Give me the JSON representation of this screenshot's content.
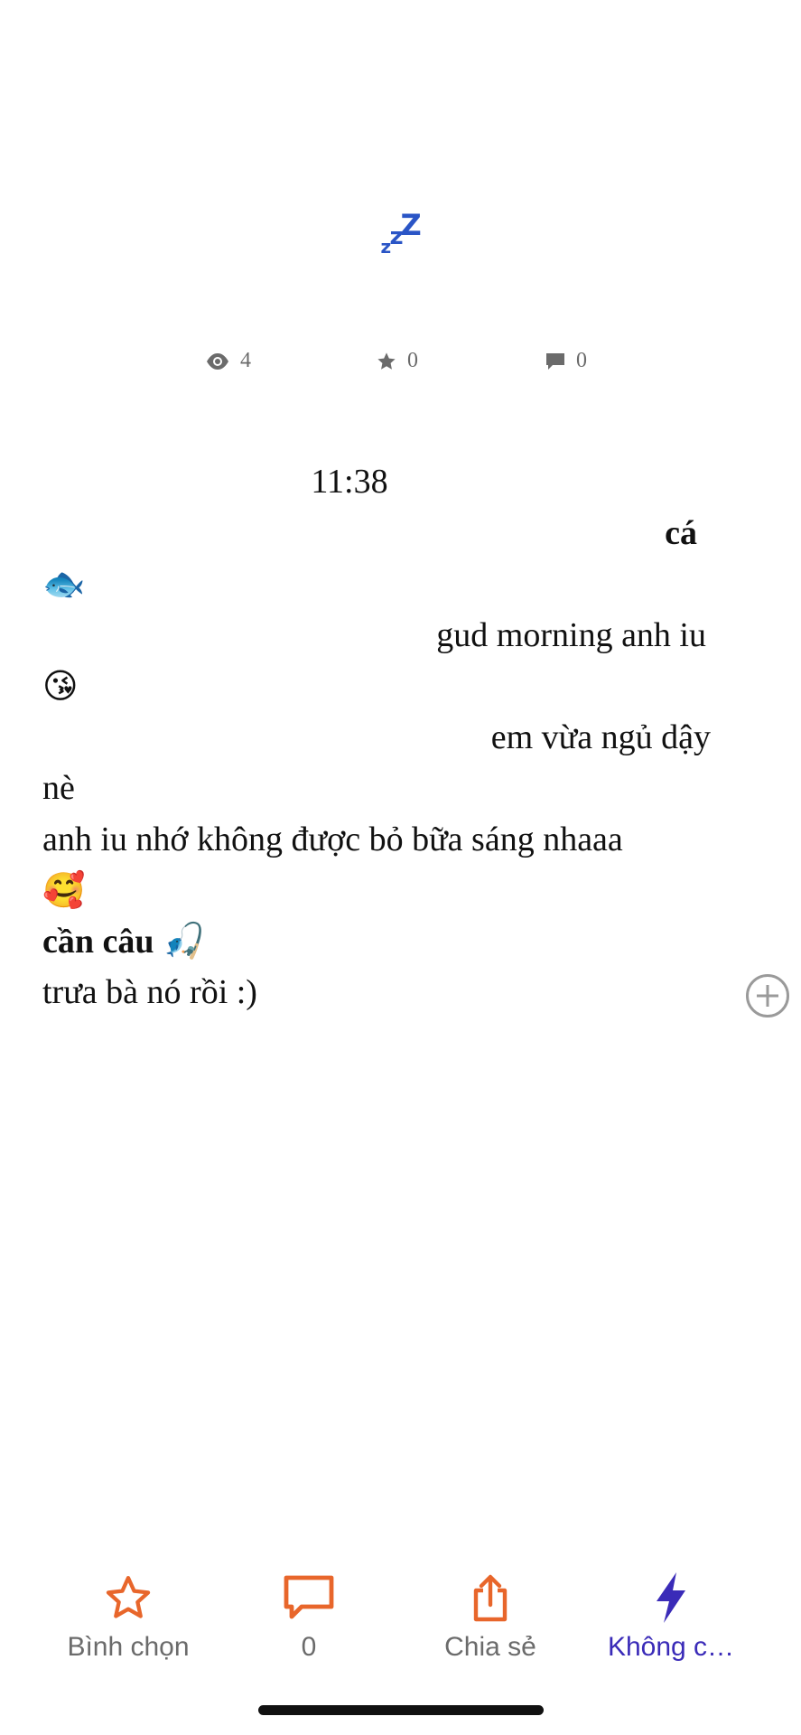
{
  "chapter": {
    "title_icon": "zzz-sleeping-icon",
    "title_letters": [
      "z",
      "z",
      "Z"
    ],
    "title_color": "#2a55c6"
  },
  "stats": {
    "views": "4",
    "votes": "0",
    "comments": "0"
  },
  "content": {
    "time": "11:38",
    "lines": [
      "cá",
      "🐟",
      "gud morning anh iu",
      "😘",
      "em vừa ngủ dậy",
      "nè",
      "anh iu nhớ không được bỏ bữa sáng nhaaa",
      "🥰",
      "cần câu 🎣",
      "trưa bà nó rồi :)"
    ]
  },
  "bottom_bar": {
    "vote_label": "Bình chọn",
    "comment_count": "0",
    "share_label": "Chia sẻ",
    "offline_label": "Không c…",
    "accent_color": "#e8662b",
    "offline_color": "#3a2bb8",
    "label_color": "#6b6b6b"
  }
}
